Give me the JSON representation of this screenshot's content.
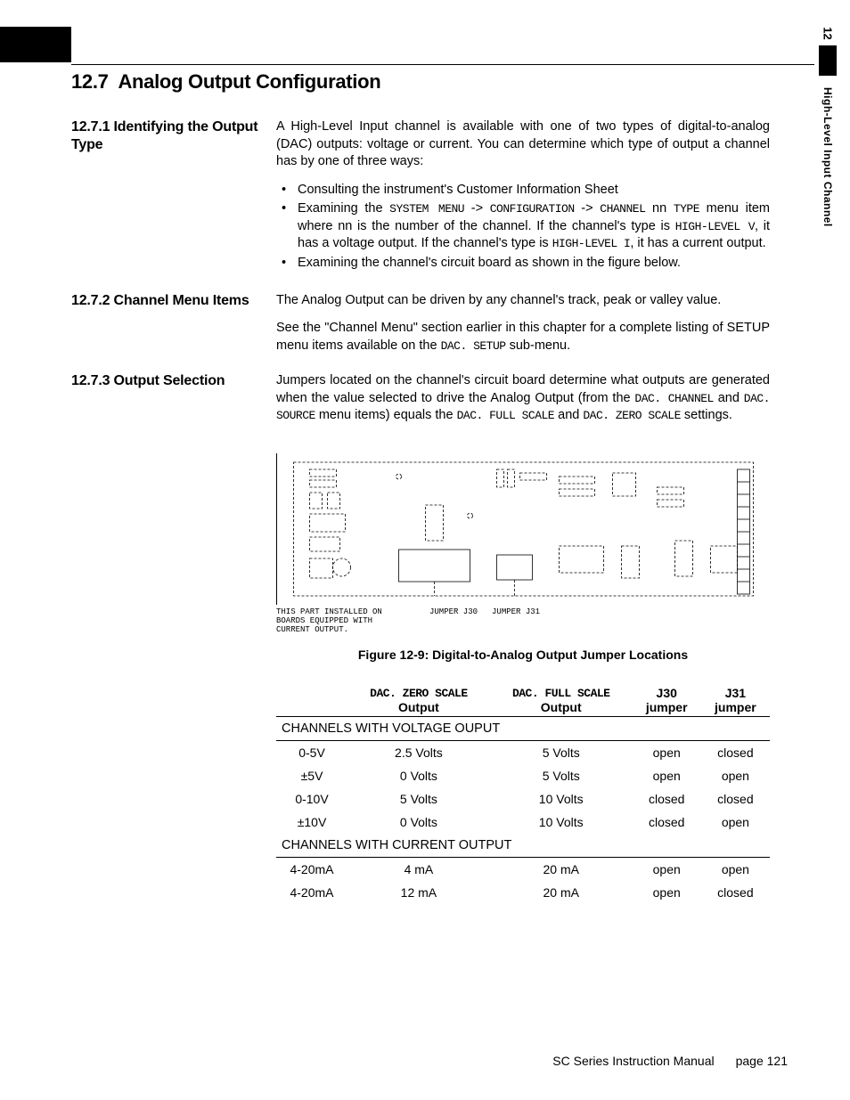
{
  "sidebar": {
    "chapter_number": "12",
    "chapter_title": "High-Level Input Channel"
  },
  "section": {
    "number": "12.7",
    "title": "Analog Output Configuration"
  },
  "sub1": {
    "heading_num": "12.7.1",
    "heading_text": "Identifying the Output Type",
    "para1": "A High-Level Input channel is available with one of two types of digital-to-analog (DAC) outputs: voltage or current.  You can determine which type of output a channel has by one of three ways:",
    "bullets": [
      {
        "text": "Consulting the instrument's Customer Information Sheet"
      },
      {
        "pre": "Examining the ",
        "m1": "SYSTEM MENU",
        "t1": " -> ",
        "m2": "CONFIGURATION",
        "t2": " -> ",
        "m3": "CHANNEL",
        "t3": " nn ",
        "m4": "TYPE",
        "mid": " menu item where nn is the number of the channel. If the channel's type is ",
        "m5": "HIGH-LEVEL V",
        "mid2": ", it has a voltage output. If the channel's type is ",
        "m6": "HIGH-LEVEL I",
        "post": ", it has a current output."
      },
      {
        "text": "Examining the channel's circuit board as shown in the figure below."
      }
    ]
  },
  "sub2": {
    "heading_num": "12.7.2",
    "heading_text": "Channel Menu Items",
    "para1": "The Analog Output can be driven by any channel's track, peak or valley value.",
    "para2_pre": "See the \"Channel Menu\" section earlier in this chapter for a complete listing of SETUP menu items available on the ",
    "para2_m1": "DAC. SETUP",
    "para2_post": " sub-menu."
  },
  "sub3": {
    "heading_num": "12.7.3",
    "heading_text": "Output Selection",
    "para_pre": "Jumpers located on the channel's circuit board determine what outputs are generated when the value selected to drive the Analog Output (from the ",
    "m1": "DAC. CHANNEL",
    "t1": " and ",
    "m2": "DAC. SOURCE",
    "t2": " menu items) equals the ",
    "m3": "DAC. FULL SCALE",
    "t3": " and ",
    "m4": "DAC. ZERO SCALE",
    "post": " settings."
  },
  "figure": {
    "note": "THIS PART INSTALLED ON BOARDS EQUIPPED WITH CURRENT OUTPUT.",
    "j30": "JUMPER J30",
    "j31": "JUMPER J31",
    "caption": "Figure 12-9: Digital-to-Analog Output Jumper Locations"
  },
  "table": {
    "headers": {
      "blank": "",
      "c1a": "DAC. ZERO SCALE",
      "c1b": "Output",
      "c2a": "DAC. FULL SCALE",
      "c2b": "Output",
      "c3a": "J30",
      "c3b": "jumper",
      "c4a": "J31",
      "c4b": "jumper"
    },
    "group1": "CHANNELS WITH VOLTAGE OUPUT",
    "rows1": [
      {
        "a": "0-5V",
        "b": "2.5 Volts",
        "c": "5 Volts",
        "d": "open",
        "e": "closed"
      },
      {
        "a": "±5V",
        "b": "0 Volts",
        "c": "5 Volts",
        "d": "open",
        "e": "open"
      },
      {
        "a": "0-10V",
        "b": "5 Volts",
        "c": "10 Volts",
        "d": "closed",
        "e": "closed"
      },
      {
        "a": "±10V",
        "b": "0 Volts",
        "c": "10 Volts",
        "d": "closed",
        "e": "open"
      }
    ],
    "group2": "CHANNELS WITH CURRENT OUTPUT",
    "rows2": [
      {
        "a": "4-20mA",
        "b": "4 mA",
        "c": "20 mA",
        "d": "open",
        "e": "open"
      },
      {
        "a": "4-20mA",
        "b": "12 mA",
        "c": "20 mA",
        "d": "open",
        "e": "closed"
      }
    ]
  },
  "footer": {
    "manual": "SC Series Instruction Manual",
    "page_label": "page 121"
  }
}
